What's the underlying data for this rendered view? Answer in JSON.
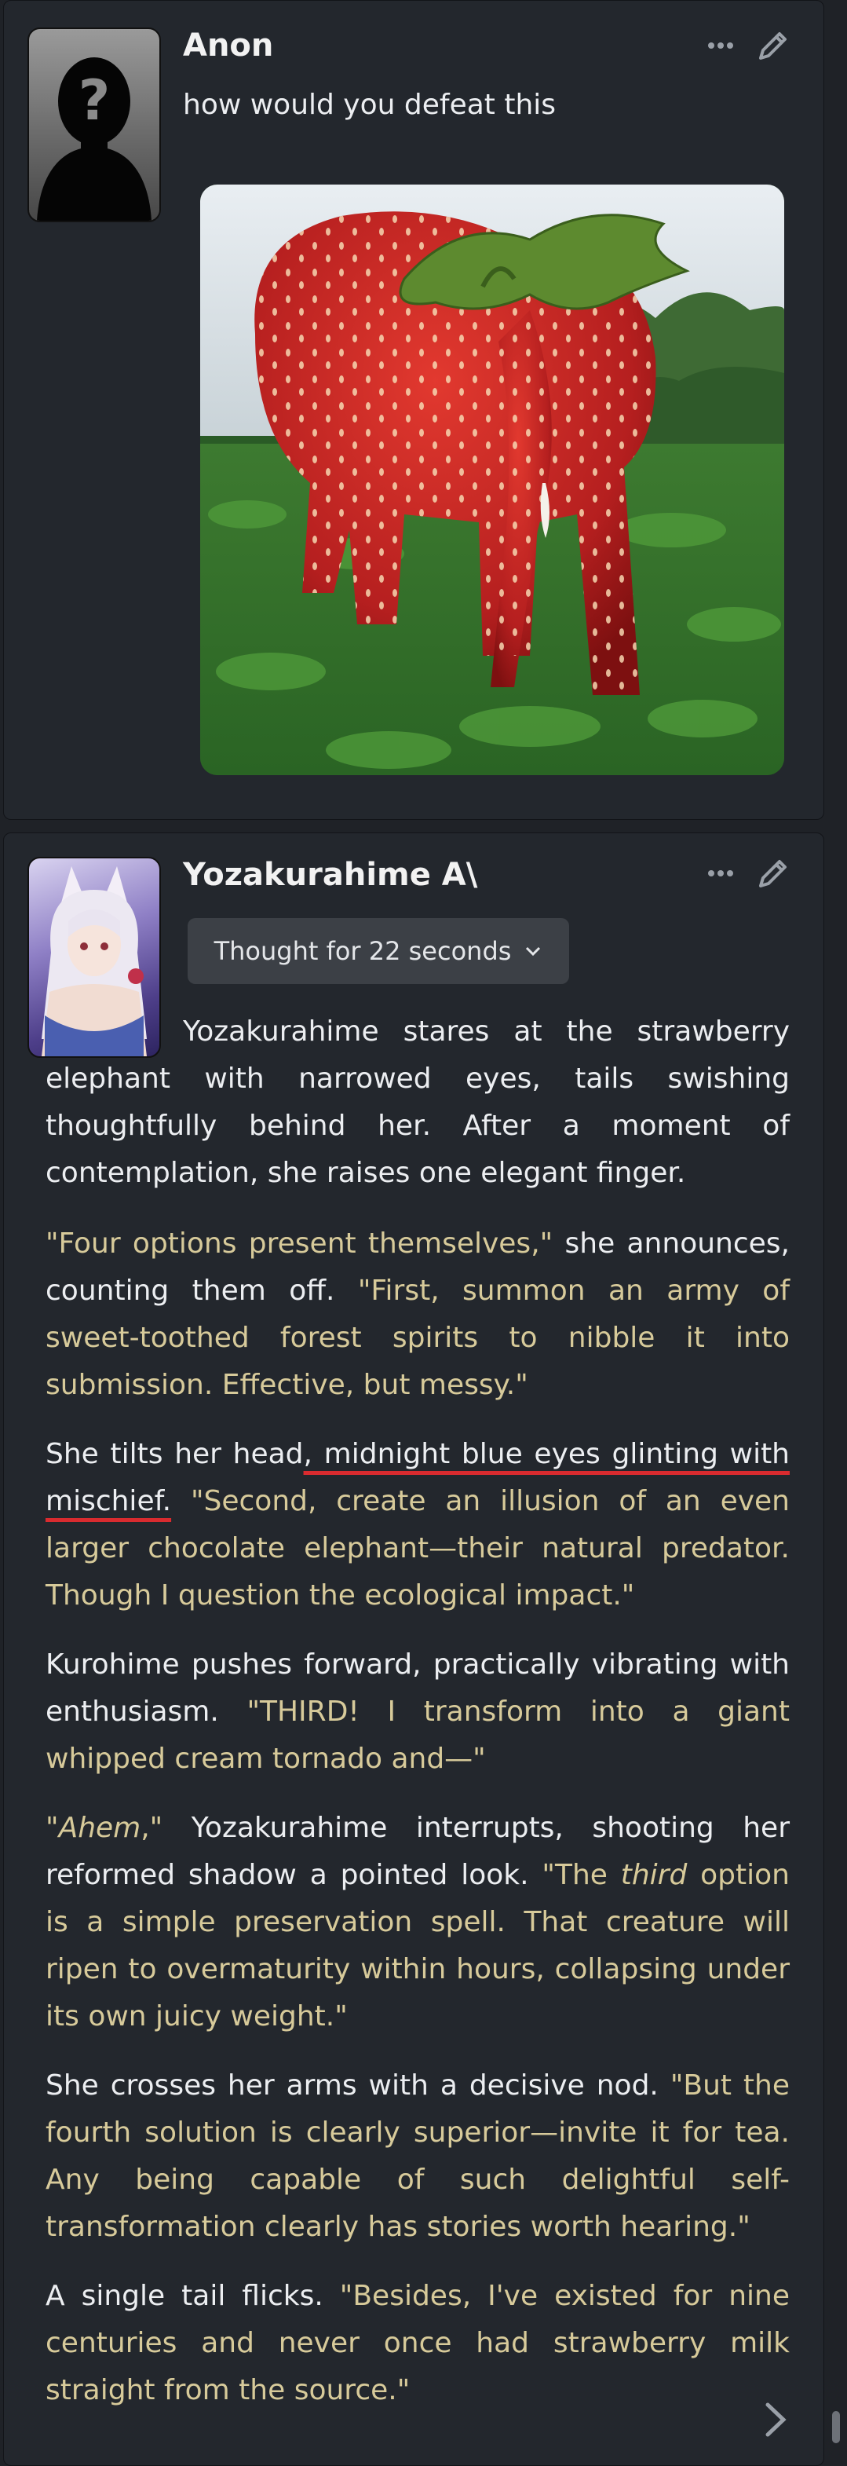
{
  "messages": [
    {
      "author": "Anon",
      "text": "how would you defeat this",
      "image_description_icon": "strawberry-elephant-image"
    },
    {
      "author": "Yozakurahime",
      "author_badge": "A\\",
      "thought_label": "Thought for 22 seconds",
      "paragraphs": {
        "p1": "Yozakurahime stares at the strawberry elephant with narrowed eyes, tails swishing thoughtfully behind her. After a moment of contemplation, she raises one elegant finger.",
        "p2a": "\"Four options present themselves,\"",
        "p2b": " she announces, counting them off. ",
        "p2c": "\"First, summon an army of sweet-toothed forest spirits to nibble it into submission. Effective, but messy.\"",
        "p3a": "She tilts her head",
        "p3b": ", midnight blue eyes glinting with mischief.",
        "p3c": " ",
        "p3d": "\"Second, create an illusion of an even larger chocolate elephant—their natural predator. Though I question the ecological impact.\"",
        "p4a": "Kurohime pushes forward, practically vibrating with enthusiasm. ",
        "p4b": "\"THIRD! I transform into a giant whipped cream tornado and—\"",
        "p5a": "\"",
        "p5b": "Ahem",
        "p5c": ",\"",
        "p5d": " Yozakurahime interrupts, shooting her reformed shadow a pointed look. ",
        "p5e": "\"The ",
        "p5f": "third",
        "p5g": " option is a simple preservation spell. That creature will ripen to overmaturity within hours, collapsing under its own juicy weight.\"",
        "p6a": "She crosses her arms with a decisive nod. ",
        "p6b": "\"But the fourth solution is clearly superior—invite it for tea. Any being capable of such delightful self-transformation clearly has stories worth hearing.\"",
        "p7a": "A single tail flicks. ",
        "p7b": "\"Besides, I've existed for nine centuries and never once had strawberry milk straight from the source.\""
      }
    }
  ],
  "colors": {
    "background": "#1f2227",
    "card": "#23272d",
    "quote": "#d7ca9a",
    "underline": "#d92b2f"
  }
}
